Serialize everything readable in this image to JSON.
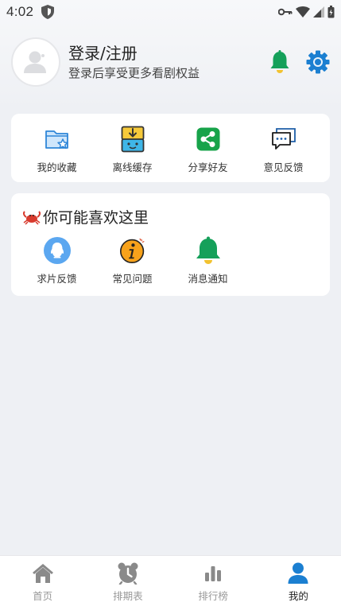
{
  "status_bar": {
    "time": "4:02"
  },
  "profile": {
    "title": "登录/注册",
    "subtitle": "登录后享受更多看剧权益"
  },
  "tools": [
    {
      "label": "我的收藏",
      "icon": "folder-star-icon"
    },
    {
      "label": "离线缓存",
      "icon": "download-box-icon"
    },
    {
      "label": "分享好友",
      "icon": "share-icon"
    },
    {
      "label": "意见反馈",
      "icon": "feedback-chat-icon"
    }
  ],
  "recommend": {
    "title": "你可能喜欢这里",
    "items": [
      {
        "label": "求片反馈",
        "icon": "qq-penguin-icon"
      },
      {
        "label": "常见问题",
        "icon": "info-icon"
      },
      {
        "label": "消息通知",
        "icon": "bell-icon"
      }
    ]
  },
  "bottom_nav": [
    {
      "label": "首页",
      "icon": "home-icon"
    },
    {
      "label": "排期表",
      "icon": "alarm-clock-icon"
    },
    {
      "label": "排行榜",
      "icon": "bar-chart-icon"
    },
    {
      "label": "我的",
      "icon": "person-icon",
      "active": true
    }
  ],
  "colors": {
    "accent_blue": "#1b7fd1",
    "bell_green": "#15a05a",
    "share_green": "#17a34a",
    "nav_inactive": "#999999"
  }
}
